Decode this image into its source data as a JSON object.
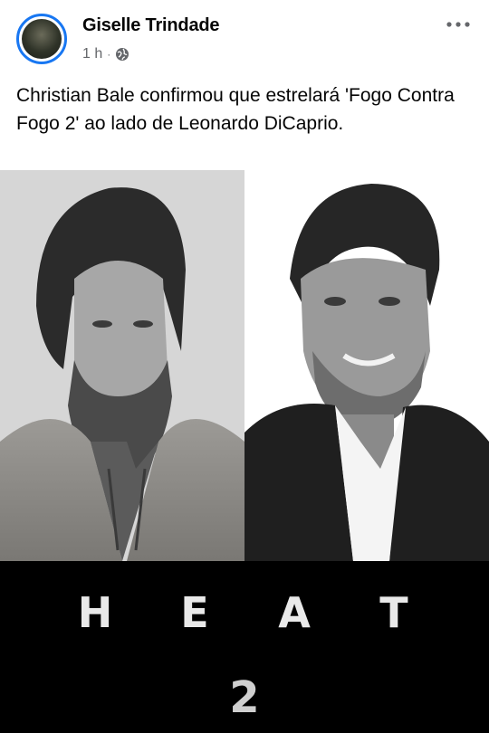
{
  "post": {
    "author": "Giselle Trindade",
    "time": "1 h",
    "separator": "·",
    "audience_icon": "globe-icon",
    "more_icon": "more-horizontal-icon",
    "text": "Christian Bale confirmou que estrelará 'Fogo Contra Fogo 2' ao lado de Leonardo DiCaprio."
  },
  "image": {
    "title_letters": [
      "H",
      "E",
      "A",
      "T"
    ],
    "title_number": "2"
  },
  "colors": {
    "accent": "#1877f2",
    "secondary_text": "#65676b",
    "primary_text": "#050505"
  }
}
